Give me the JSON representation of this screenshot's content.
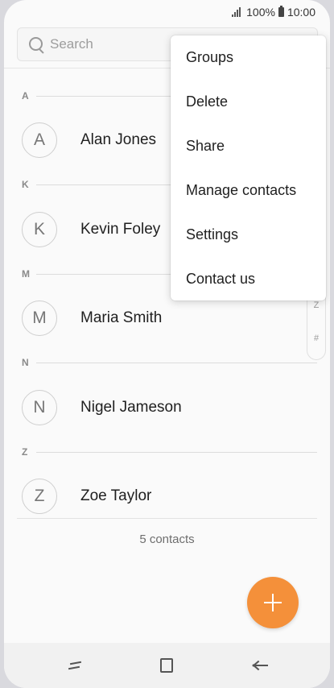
{
  "status_bar": {
    "battery": "100%",
    "time": "10:00"
  },
  "search": {
    "placeholder": "Search"
  },
  "sections": [
    {
      "letter": "A",
      "contact": {
        "initial": "A",
        "name": "Alan Jones"
      }
    },
    {
      "letter": "K",
      "contact": {
        "initial": "K",
        "name": "Kevin Foley"
      }
    },
    {
      "letter": "M",
      "contact": {
        "initial": "M",
        "name": "Maria Smith"
      }
    },
    {
      "letter": "N",
      "contact": {
        "initial": "N",
        "name": "Nigel Jameson"
      }
    },
    {
      "letter": "Z",
      "contact": {
        "initial": "Z",
        "name": "Zoe Taylor"
      }
    }
  ],
  "contacts_count": "5 contacts",
  "index_bar": [
    "Z",
    "#"
  ],
  "menu": {
    "items": [
      "Groups",
      "Delete",
      "Share",
      "Manage contacts",
      "Settings",
      "Contact us"
    ]
  },
  "colors": {
    "fab": "#f4903a"
  }
}
